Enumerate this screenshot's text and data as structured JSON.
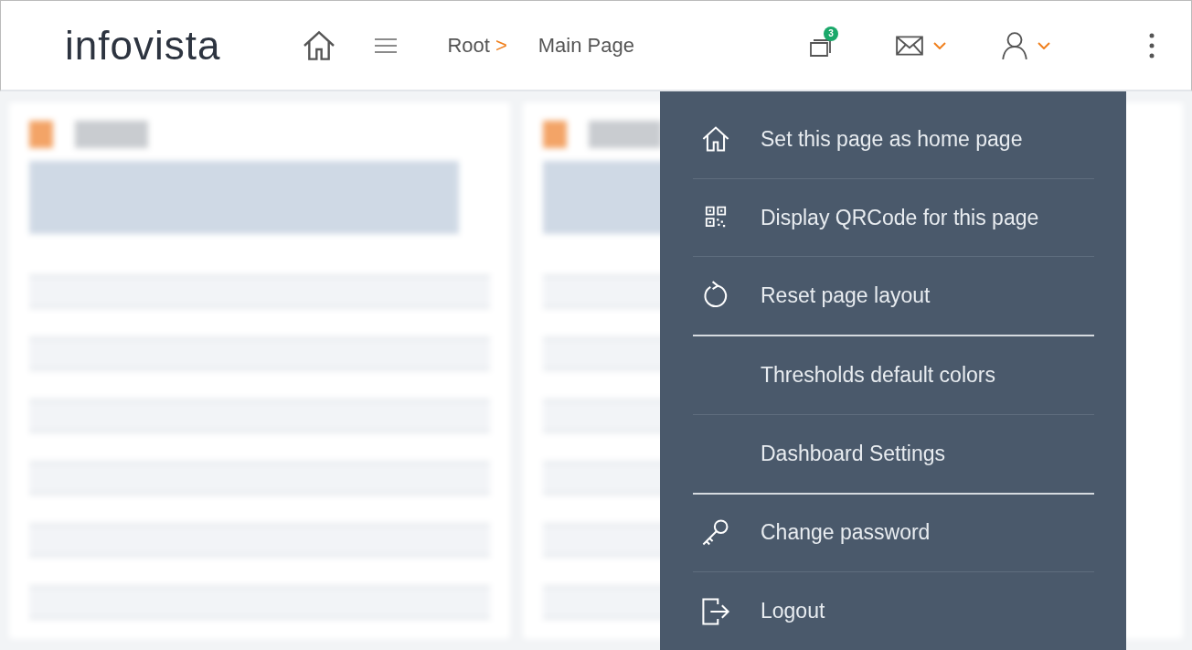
{
  "header": {
    "logo": "infovista",
    "breadcrumb": [
      {
        "label": "Root",
        "separator": ">"
      },
      {
        "label": "Main Page"
      }
    ],
    "notifications": {
      "badge": "3"
    }
  },
  "user_menu": {
    "open": true,
    "groups": [
      {
        "items": [
          {
            "kind": "home",
            "label": "Set this page as home page"
          },
          {
            "kind": "qrcode",
            "label": "Display QRCode for this page"
          },
          {
            "kind": "reset",
            "label": "Reset page layout"
          }
        ]
      },
      {
        "items": [
          {
            "kind": "plain",
            "label": "Thresholds default colors"
          },
          {
            "kind": "plain",
            "label": "Dashboard Settings"
          }
        ]
      },
      {
        "items": [
          {
            "kind": "key",
            "label": "Change password"
          },
          {
            "kind": "logout",
            "label": "Logout"
          }
        ]
      }
    ]
  }
}
